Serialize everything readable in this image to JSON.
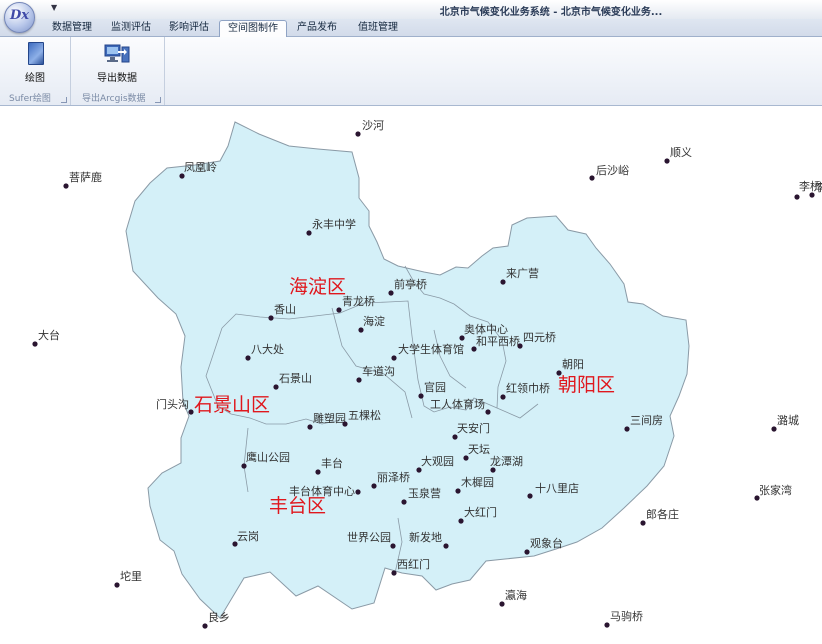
{
  "window": {
    "title": "北京市气候变化业务系统 - 北京市气候变化业务..."
  },
  "app_logo_text": "Dx",
  "tabs": [
    "数据管理",
    "监测评估",
    "影响评估",
    "空间图制作",
    "产品发布",
    "值班管理"
  ],
  "active_tab": "空间图制作",
  "ribbon": {
    "groups": [
      {
        "caption": "Sufer绘图",
        "button": "绘图",
        "icon": "draw-icon"
      },
      {
        "caption": "导出Arcgis数据",
        "button": "导出数据",
        "icon": "export-data-icon"
      }
    ]
  },
  "map": {
    "fill_color": "#d4f0f8",
    "outline_color": "#8a9aa6",
    "point_color": "#2a1530",
    "district_label_color": "#e0171d",
    "districts": [
      "海淀区",
      "石景山区",
      "朝阳区",
      "丰台区"
    ],
    "stations": [
      "沙河",
      "顺义",
      "后沙峪",
      "凤凰岭",
      "菩萨鹿",
      "李桥",
      "李",
      "永丰中学",
      "来广营",
      "前亭桥",
      "青龙桥",
      "香山",
      "海淀",
      "奥体中心",
      "四元桥",
      "大台",
      "八大处",
      "大学生体育馆",
      "和平西桥",
      "车道沟",
      "朝阳",
      "石景山",
      "官园",
      "红领巾桥",
      "门头沟",
      "工人体育场",
      "三间房",
      "潞城",
      "雕塑园",
      "五棵松",
      "天安门",
      "天坛",
      "鹰山公园",
      "大观园",
      "龙潭湖",
      "丰台",
      "丽泽桥",
      "木樨园",
      "十八里店",
      "张家湾",
      "丰台体育中心",
      "玉泉营",
      "大红门",
      "郎各庄",
      "云岗",
      "新发地",
      "世界公园",
      "观象台",
      "西红门",
      "坨里",
      "瀛海",
      "马驹桥",
      "良乡"
    ]
  }
}
